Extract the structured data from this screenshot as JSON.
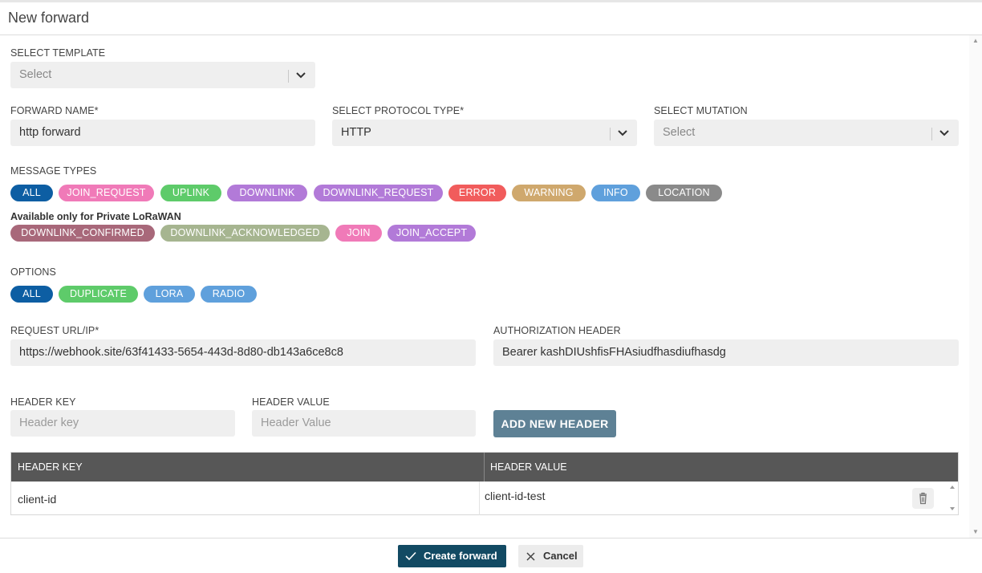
{
  "header": {
    "title": "New forward"
  },
  "template": {
    "label": "SELECT TEMPLATE",
    "value": "Select"
  },
  "forward_name": {
    "label": "FORWARD NAME*",
    "value": "http forward"
  },
  "protocol": {
    "label": "SELECT PROTOCOL TYPE*",
    "value": "HTTP"
  },
  "mutation": {
    "label": "SELECT MUTATION",
    "value": "Select"
  },
  "message_types": {
    "label": "MESSAGE TYPES",
    "tags": [
      {
        "label": "ALL",
        "color": "#0d5ea3"
      },
      {
        "label": "JOIN_REQUEST",
        "color": "#f07ab8"
      },
      {
        "label": "UPLINK",
        "color": "#5ecb6a"
      },
      {
        "label": "DOWNLINK",
        "color": "#b27ad8"
      },
      {
        "label": "DOWNLINK_REQUEST",
        "color": "#b27ad8"
      },
      {
        "label": "ERROR",
        "color": "#f15c5c"
      },
      {
        "label": "WARNING",
        "color": "#cfa86d"
      },
      {
        "label": "INFO",
        "color": "#5fa0dc"
      },
      {
        "label": "LOCATION",
        "color": "#8a8a8a"
      }
    ],
    "private_note": "Available only for Private LoRaWAN",
    "private_tags": [
      {
        "label": "DOWNLINK_CONFIRMED",
        "color": "#a8687a"
      },
      {
        "label": "DOWNLINK_ACKNOWLEDGED",
        "color": "#a6b590"
      },
      {
        "label": "JOIN",
        "color": "#f07ab8"
      },
      {
        "label": "JOIN_ACCEPT",
        "color": "#b27ad8"
      }
    ]
  },
  "options": {
    "label": "OPTIONS",
    "tags": [
      {
        "label": "ALL",
        "color": "#0d5ea3"
      },
      {
        "label": "DUPLICATE",
        "color": "#5ecb6a"
      },
      {
        "label": "LORA",
        "color": "#5fa0dc"
      },
      {
        "label": "RADIO",
        "color": "#5fa0dc"
      }
    ]
  },
  "request_url": {
    "label": "REQUEST URL/IP*",
    "value": "https://webhook.site/63f41433-5654-443d-8d80-db143a6ce8c8"
  },
  "auth_header": {
    "label": "AUTHORIZATION HEADER",
    "value": "Bearer kashDIUshfisFHAsiudfhasdiufhasdg"
  },
  "header_key": {
    "label": "HEADER KEY",
    "placeholder": "Header key"
  },
  "header_value": {
    "label": "HEADER VALUE",
    "placeholder": "Header Value"
  },
  "add_header_label": "ADD NEW HEADER",
  "headers_table": {
    "columns": [
      "HEADER KEY",
      "HEADER VALUE"
    ],
    "rows": [
      {
        "key": "client-id",
        "value": "client-id-test"
      }
    ]
  },
  "footer": {
    "create_label": "Create forward",
    "cancel_label": "Cancel"
  },
  "icons": {
    "check": "check-icon",
    "close": "close-icon",
    "trash": "trash-icon",
    "chevron": "chevron-down-icon"
  }
}
